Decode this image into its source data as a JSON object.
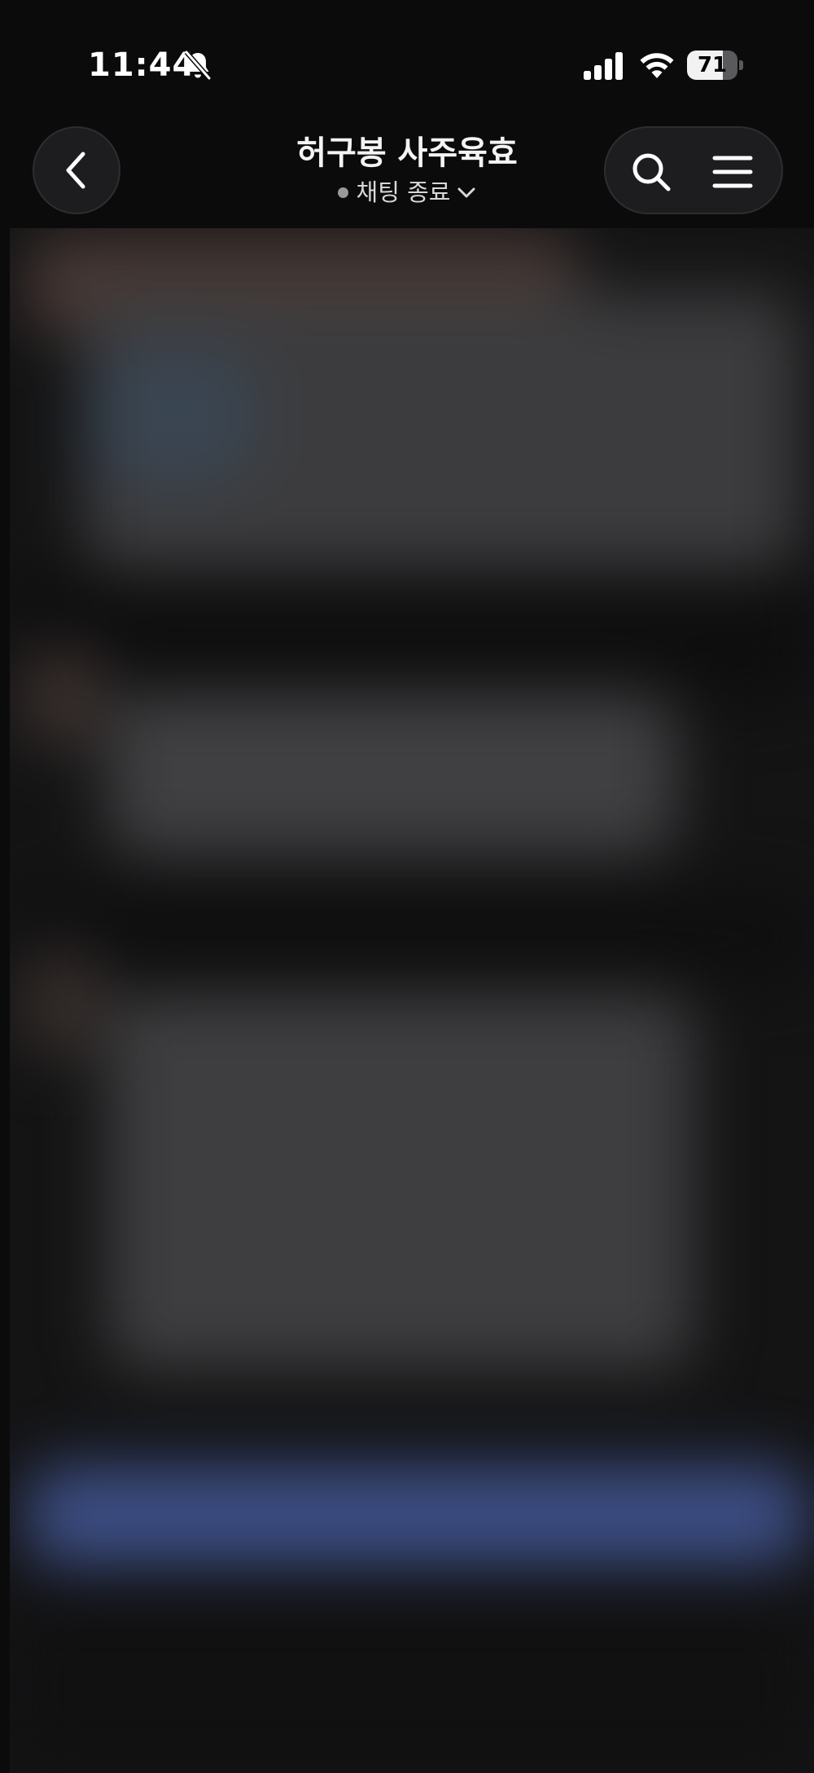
{
  "status_bar": {
    "time": "11:44",
    "battery_level": "71",
    "battery_percent": 71,
    "icons": [
      "bell-slash-icon",
      "cellular-signal-icon",
      "wifi-icon",
      "battery-icon"
    ]
  },
  "header": {
    "title": "허구봉 사주육효",
    "subtitle": "채팅 종료",
    "icons": [
      "chevron-left-icon",
      "chevron-down-icon",
      "search-icon",
      "menu-icon"
    ]
  },
  "colors": {
    "background": "#0b0b0c",
    "button_bg": "#1d1d1f",
    "accent_blurred": "#3d4f86"
  }
}
